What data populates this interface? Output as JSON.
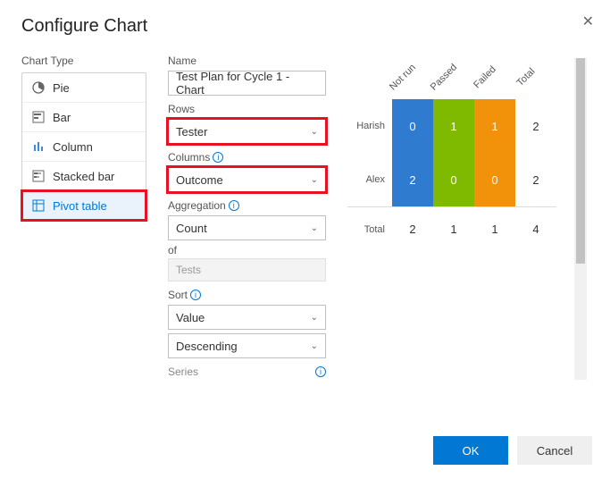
{
  "dialog": {
    "title": "Configure Chart",
    "close_tooltip": "Close"
  },
  "chart_type": {
    "label": "Chart Type",
    "items": [
      {
        "icon": "pie-icon",
        "label": "Pie"
      },
      {
        "icon": "bar-icon",
        "label": "Bar"
      },
      {
        "icon": "column-icon",
        "label": "Column"
      },
      {
        "icon": "stacked-bar-icon",
        "label": "Stacked bar"
      },
      {
        "icon": "pivot-table-icon",
        "label": "Pivot table"
      }
    ],
    "selected_index": 4
  },
  "form": {
    "name_label": "Name",
    "name_value": "Test Plan for Cycle 1 - Chart",
    "rows_label": "Rows",
    "rows_value": "Tester",
    "columns_label": "Columns",
    "columns_value": "Outcome",
    "aggregation_label": "Aggregation",
    "aggregation_value": "Count",
    "of_label": "of",
    "of_value": "Tests",
    "sort_label": "Sort",
    "sort_by": "Value",
    "sort_dir": "Descending",
    "series_label": "Series"
  },
  "chart_data": {
    "type": "table",
    "row_field": "Tester",
    "column_field": "Outcome",
    "columns": [
      "Not run",
      "Passed",
      "Failed",
      "Total"
    ],
    "column_colors": [
      "#2f7bd0",
      "#7fba00",
      "#f2910a",
      null
    ],
    "rows": [
      {
        "label": "Harish",
        "cells": [
          0,
          1,
          1,
          2
        ]
      },
      {
        "label": "Alex",
        "cells": [
          2,
          0,
          0,
          2
        ]
      }
    ],
    "totals": {
      "label": "Total",
      "cells": [
        2,
        1,
        1,
        4
      ]
    }
  },
  "footer": {
    "ok": "OK",
    "cancel": "Cancel"
  }
}
